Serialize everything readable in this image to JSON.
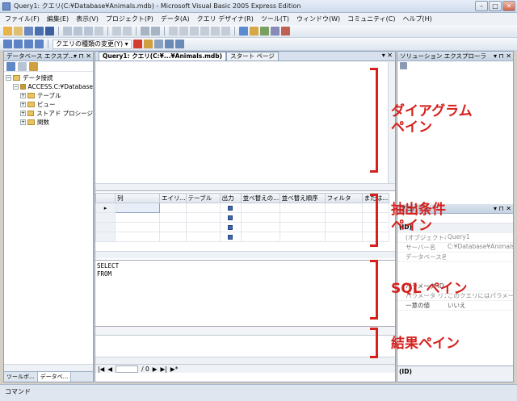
{
  "window": {
    "title": "Query1: クエリ(C:¥Database¥Animals.mdb) - Microsoft Visual Basic 2005 Express Edition"
  },
  "menu": [
    "ファイル(F)",
    "編集(E)",
    "表示(V)",
    "プロジェクト(P)",
    "データ(A)",
    "クエリ デザイナ(R)",
    "ツール(T)",
    "ウィンドウ(W)",
    "コミュニティ(C)",
    "ヘルプ(H)"
  ],
  "toolbar2": {
    "query_type_label": "クエリの種類の変更(Y) ▾"
  },
  "database_explorer": {
    "header": "データベース エクスプ...",
    "nodes": {
      "data_connections": "データ接続",
      "connection": "ACCESS.C:¥Database",
      "tables": "テーブル",
      "views": "ビュー",
      "stored_procs": "ストアド プロシージ",
      "functions": "関数"
    },
    "tabs": {
      "toolbox": "ツールボ...",
      "db_explorer": "データベ..."
    }
  },
  "document": {
    "tab_active": "Query1: クエリ(C:¥...¥Animals.mdb)",
    "tab_start": "スタート ページ",
    "controls": "▾ ✕"
  },
  "criteria_grid": {
    "columns": [
      "列",
      "エイリ...",
      "テーブル",
      "出力",
      "並べ替えの...",
      "並べ替え順序",
      "フィルタ",
      "または..."
    ]
  },
  "sql": {
    "line1": "SELECT",
    "line2": "FROM"
  },
  "result_nav": {
    "of_total": "/ 0"
  },
  "solution_explorer": {
    "header": "ソリューション エクスプローラ"
  },
  "properties": {
    "header": "プロパティ",
    "section": "(ID)",
    "rows": [
      {
        "k": "(オブジェクト名)",
        "v": "Query1",
        "gray": true
      },
      {
        "k": "サーバー名",
        "v": "C:¥Database¥Animals",
        "gray": true
      },
      {
        "k": "データベース名",
        "v": "",
        "gray": true
      },
      {
        "k": "パラメータ ID の",
        "v": "",
        "gray": false
      },
      {
        "k": "パラメータ リスト",
        "v": "このクエリにはパラメー",
        "gray": true
      },
      {
        "k": "一意の値",
        "v": "いいえ",
        "gray": false
      }
    ],
    "desc": "(ID)"
  },
  "status": {
    "text": "コマンド"
  },
  "annotations": {
    "diagram_l1": "ダイアグラム",
    "diagram_l2": "ペイン",
    "criteria_l1": "抽出条件",
    "criteria_l2": "ペイン",
    "sql": "SQL ペイン",
    "results": "結果ペイン"
  },
  "colors": {
    "annotation": "#d5201c"
  }
}
